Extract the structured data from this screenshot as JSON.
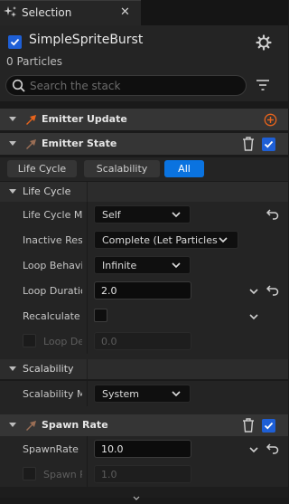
{
  "tab": {
    "title": "Selection",
    "icon": "selection-sparkle-icon",
    "close_icon": "close-icon"
  },
  "emitter": {
    "name": "SimpleSpriteBurst",
    "enabled": true,
    "particles": "0 Particles"
  },
  "search": {
    "placeholder": "Search the stack",
    "value": ""
  },
  "sections": {
    "emitter_update": {
      "label": "Emitter Update"
    },
    "emitter_state": {
      "label": "Emitter State",
      "enabled": true
    },
    "spawn_rate": {
      "label": "Spawn Rate",
      "enabled": true
    }
  },
  "filters": {
    "life_cycle": "Life Cycle",
    "scalability": "Scalability",
    "all": "All",
    "active": "All"
  },
  "life_cycle": {
    "label": "Life Cycle",
    "rows": [
      {
        "label": "Life Cycle Mode",
        "value": "Self"
      },
      {
        "label": "Inactive Response",
        "value": "Complete (Let Particles"
      },
      {
        "label": "Loop Behavior",
        "value": "Infinite"
      },
      {
        "label": "Loop Duration",
        "value": "2.0"
      },
      {
        "label": "Recalculate Duration",
        "value": ""
      },
      {
        "label": "Loop Delay",
        "value": "0.0"
      }
    ]
  },
  "scalability": {
    "label": "Scalability",
    "rows": [
      {
        "label": "Scalability Mode",
        "value": "System"
      }
    ]
  },
  "spawn_rate_rows": [
    {
      "label": "SpawnRate",
      "value": "10.0"
    },
    {
      "label": "Spawn Probability",
      "value": "1.0"
    }
  ],
  "colors": {
    "accent": "#0a73e0",
    "module_orange": "#e8641c",
    "module_brown": "#9a6e55"
  }
}
